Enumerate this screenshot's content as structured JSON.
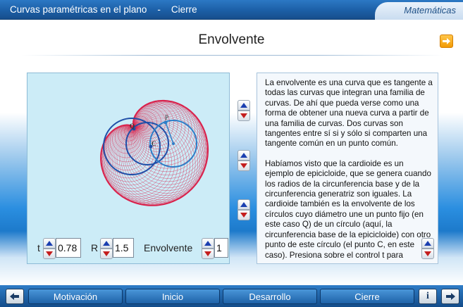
{
  "window": {
    "title": "Curvas paramétricas en el plano    -    Cierre",
    "subject": "Matemáticas"
  },
  "page": {
    "title": "Envolvente",
    "next_icon": "arrow-right-icon"
  },
  "applet": {
    "point_labels": {
      "p": "P",
      "q": "Q",
      "c": "C"
    },
    "params": {
      "t_label": "t",
      "t_value": "0.78",
      "r_label": "R",
      "r_value": "1.5",
      "env_label": "Envolvente",
      "env_value": "1"
    },
    "colors": {
      "background": "#ccecf7",
      "envelope": "#d9214b",
      "circles": "#2d7fc9",
      "base": "#1f4fa8"
    }
  },
  "text": {
    "paragraph1": "La envolvente es una curva que es tangente a todas las curvas que integran una familia de curvas. De ahí que pueda verse como una forma de obtener una nueva curva a partir de una familia de curvas. Dos curvas son tangentes entre sí si y sólo si comparten una tangente común en un punto común.",
    "paragraph2": "Habíamos visto que la cardioide es un ejemplo de epicicloide, que se genera cuando los radios de la circunferencia base y de la circunferencia generatriz son iguales. La cardioide también es la envolvente de los círculos cuyo diámetro une un punto fijo (en este caso Q) de un círculo (aquí, la circunferencia base de la epicicloide) con otro punto de este círculo (el punto C, en este caso). Presiona sobre el control t para"
  },
  "nav": {
    "prev_icon": "arrow-left-icon",
    "motivacion": "Motivación",
    "inicio": "Inicio",
    "desarrollo": "Desarrollo",
    "cierre": "Cierre",
    "info": "i",
    "next_icon": "arrow-right-icon"
  }
}
